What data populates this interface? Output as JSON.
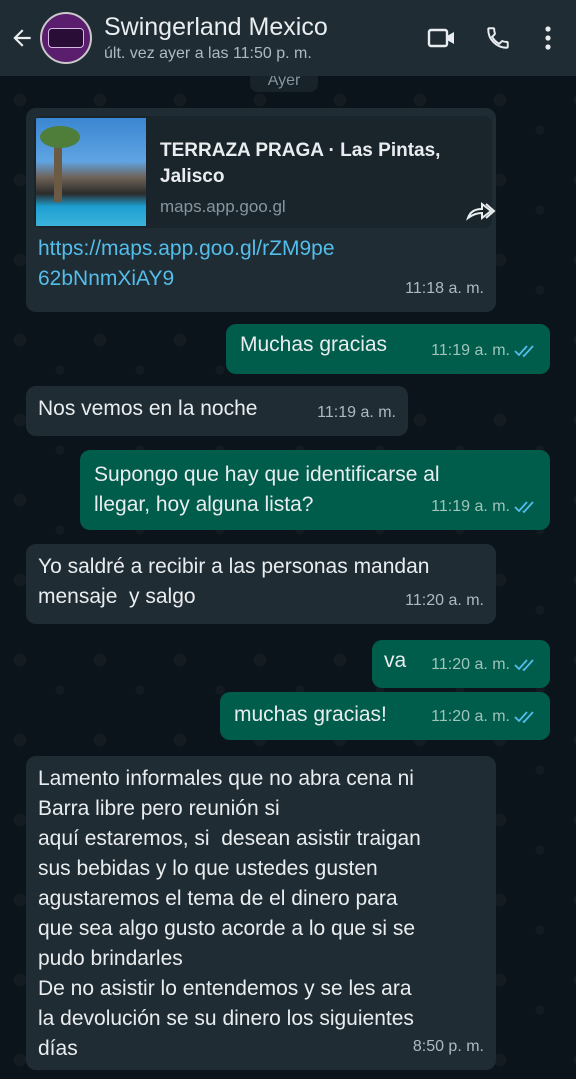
{
  "header": {
    "contact_name": "Swingerland Mexico",
    "last_seen": "últ. vez ayer a las 11:50 p. m."
  },
  "date_chip": "Ayer",
  "messages": [
    {
      "direction": "in",
      "link_preview": {
        "title": "TERRAZA PRAGA · Las Pintas, Jalisco",
        "domain": "maps.app.goo.gl"
      },
      "text": "https://maps.app.goo.gl/rZM9pe62bNnmXiAY9",
      "time": "11:18 a. m."
    },
    {
      "direction": "out",
      "text": "Muchas gracias",
      "time": "11:19 a. m.",
      "status": "read"
    },
    {
      "direction": "in",
      "text": "Nos vemos en la noche",
      "time": "11:19 a. m."
    },
    {
      "direction": "out",
      "text": "Supongo que hay que identificarse al\nllegar, hoy alguna lista?",
      "time": "11:19 a. m.",
      "status": "read"
    },
    {
      "direction": "in",
      "text": "Yo saldré a recibir a las personas mandan\nmensaje  y salgo",
      "time": "11:20 a. m."
    },
    {
      "direction": "out",
      "text": "va",
      "time": "11:20 a. m.",
      "status": "read"
    },
    {
      "direction": "out",
      "text": "muchas gracias!",
      "time": "11:20 a. m.",
      "status": "read"
    },
    {
      "direction": "in",
      "text": "Lamento informales que no abra cena ni\nBarra libre pero reunión si\naquí estaremos, si  desean asistir traigan\nsus bebidas y lo que ustedes gusten\nagustaremos el tema de el dinero para\nque sea algo gusto acorde a lo que si se\npudo brindarles\nDe no asistir lo entendemos y se les ara\nla devolución se su dinero los siguientes\ndías",
      "time": "8:50 p. m."
    }
  ],
  "icons": {
    "back": "back-arrow-icon",
    "video": "video-call-icon",
    "call": "phone-call-icon",
    "menu": "more-vert-icon",
    "forward": "forward-icon",
    "ticks": "double-check-icon"
  },
  "colors": {
    "header_bg": "#1f2c34",
    "chat_bg": "#0b141a",
    "incoming_bubble": "#202c33",
    "outgoing_bubble": "#005c4b",
    "link_color": "#53bdeb",
    "read_ticks": "#53bdeb"
  }
}
